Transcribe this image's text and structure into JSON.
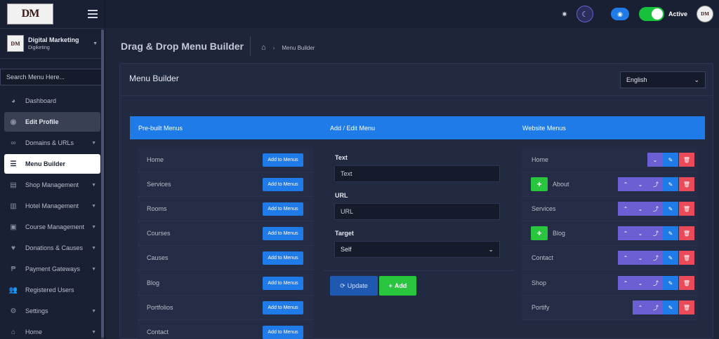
{
  "sidebar": {
    "logo_text": "DM",
    "account": {
      "name": "Digital Marketing",
      "sub": "Digiketing"
    },
    "search_placeholder": "Search Menu Here...",
    "items": [
      {
        "label": "Dashboard",
        "icon": "palette-icon"
      },
      {
        "label": "Edit Profile",
        "icon": "user-circle-icon"
      },
      {
        "label": "Domains & URLs",
        "icon": "link-icon"
      },
      {
        "label": "Menu Builder",
        "icon": "bars-icon"
      },
      {
        "label": "Shop Management",
        "icon": "store-icon"
      },
      {
        "label": "Hotel Management",
        "icon": "hotel-icon"
      },
      {
        "label": "Course Management",
        "icon": "book-icon"
      },
      {
        "label": "Donations & Causes",
        "icon": "hand-holding-icon"
      },
      {
        "label": "Payment Gateways",
        "icon": "payment-icon"
      },
      {
        "label": "Registered Users",
        "icon": "users-icon"
      },
      {
        "label": "Settings",
        "icon": "gear-icon"
      },
      {
        "label": "Home",
        "icon": "home-icon"
      }
    ]
  },
  "topbar": {
    "status_label": "Active",
    "avatar_text": "DM"
  },
  "header": {
    "title": "Drag & Drop Menu Builder",
    "breadcrumb_current": "Menu Builder"
  },
  "card": {
    "title": "Menu Builder",
    "language": "English",
    "columns": [
      "Pre-built Menus",
      "Add / Edit Menu",
      "Website Menus"
    ]
  },
  "prebuilt": {
    "add_label": "Add to Menus",
    "items": [
      "Home",
      "Services",
      "Rooms",
      "Courses",
      "Causes",
      "Blog",
      "Portfolios",
      "Contact"
    ]
  },
  "form": {
    "text_label": "Text",
    "text_placeholder": "Text",
    "url_label": "URL",
    "url_placeholder": "URL",
    "target_label": "Target",
    "target_value": "Self",
    "update_label": "Update",
    "add_label": "Add"
  },
  "website_menus": [
    "Home",
    "About",
    "Services",
    "Blog",
    "Contact",
    "Shop",
    "Portify"
  ],
  "colors": {
    "primary": "#1f7be8",
    "success": "#29c53f",
    "purple": "#6c5fd3",
    "danger": "#ea4a5a"
  }
}
